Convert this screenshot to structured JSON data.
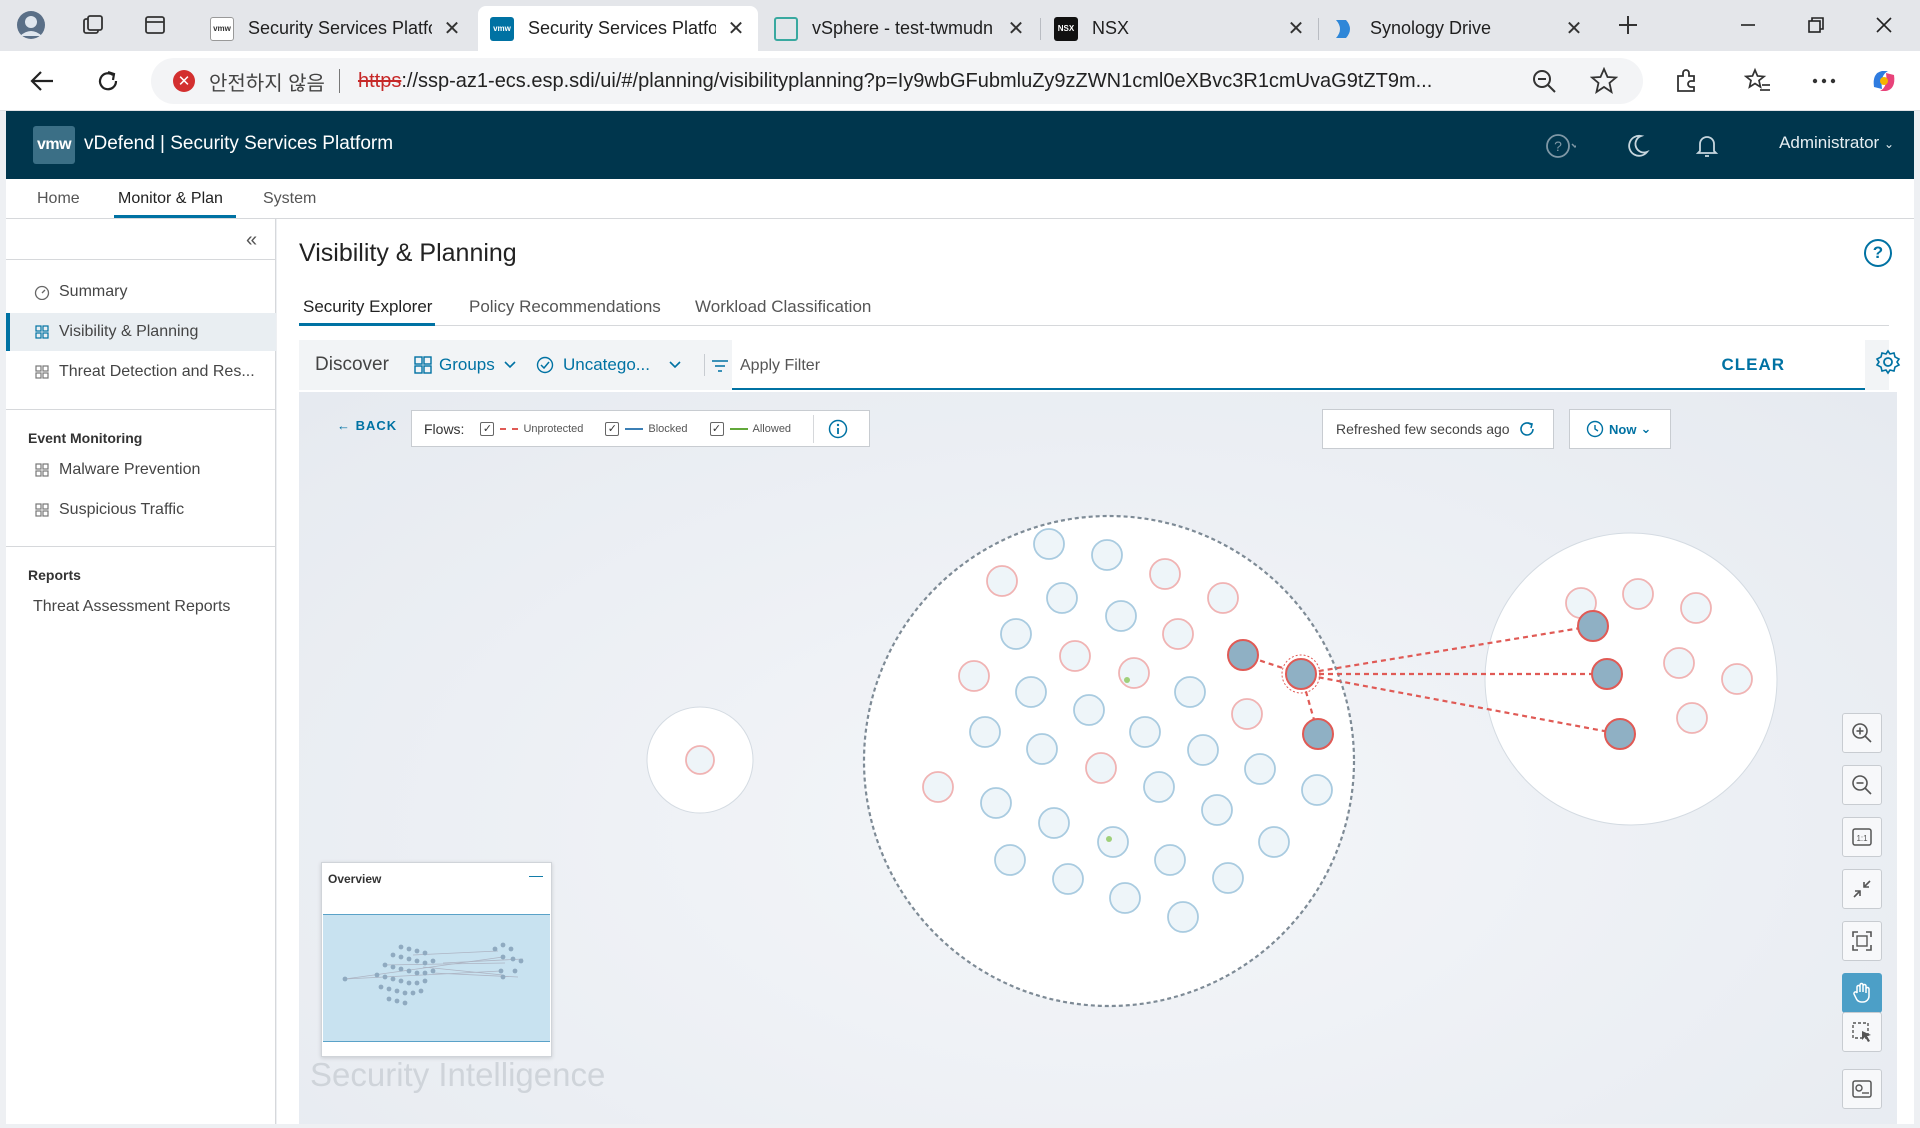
{
  "browser": {
    "tabs": [
      {
        "title": "Security Services Platfor",
        "favicon": "vmw"
      },
      {
        "title": "Security Services Platfor",
        "favicon": "vmw",
        "active": true
      },
      {
        "title": "vSphere - test-twmudn",
        "favicon": "vsphere"
      },
      {
        "title": "NSX",
        "favicon": "nsx"
      },
      {
        "title": "Synology Drive",
        "favicon": "synology"
      }
    ],
    "security_label": "안전하지 않음",
    "url_scheme": "https",
    "url_rest": "://ssp-az1-ecs.esp.sdi/ui/#/planning/visibilityplanning?p=Iy9wbGFubmluZy9zZWN1cml0eXBvc3R1cmUvaG9tZT9m..."
  },
  "app": {
    "logo_text": "vmw",
    "title": "vDefend | Security Services Platform",
    "user": "Administrator"
  },
  "main_nav": [
    "Home",
    "Monitor & Plan",
    "System"
  ],
  "sidebar": {
    "items": [
      {
        "label": "Summary",
        "icon": "gauge-icon"
      },
      {
        "label": "Visibility & Planning",
        "icon": "grid-icon",
        "active": true
      },
      {
        "label": "Threat Detection and Res...",
        "icon": "grid-icon"
      }
    ],
    "event_monitoring": {
      "heading": "Event Monitoring",
      "items": [
        "Malware Prevention",
        "Suspicious Traffic"
      ]
    },
    "reports": {
      "heading": "Reports",
      "items": [
        "Threat Assessment Reports"
      ]
    }
  },
  "page": {
    "title": "Visibility & Planning",
    "subtabs": [
      "Security Explorer",
      "Policy Recommendations",
      "Workload Classification"
    ]
  },
  "filter": {
    "discover_label": "Discover",
    "groups_label": "Groups",
    "category_label": "Uncatego...",
    "apply_placeholder": "Apply Filter",
    "clear_label": "CLEAR"
  },
  "graph": {
    "back_label": "BACK",
    "flows_label": "Flows:",
    "flow_types": [
      {
        "label": "Unprotected",
        "color": "#e05a55",
        "dashed": true
      },
      {
        "label": "Blocked",
        "color": "#3b7fb5",
        "dashed": false
      },
      {
        "label": "Allowed",
        "color": "#62a83a",
        "dashed": false
      }
    ],
    "refresh_text": "Refreshed few seconds ago",
    "time_label": "Now",
    "overview_label": "Overview",
    "watermark": "Security Intelligence"
  },
  "colors": {
    "header_bg": "#00364d",
    "accent": "#0072a3",
    "unprotected": "#e05a55",
    "node_fill": "#e9f2f7",
    "node_stroke": "#a9cbe0",
    "selected_node": "#8fb0c4"
  }
}
